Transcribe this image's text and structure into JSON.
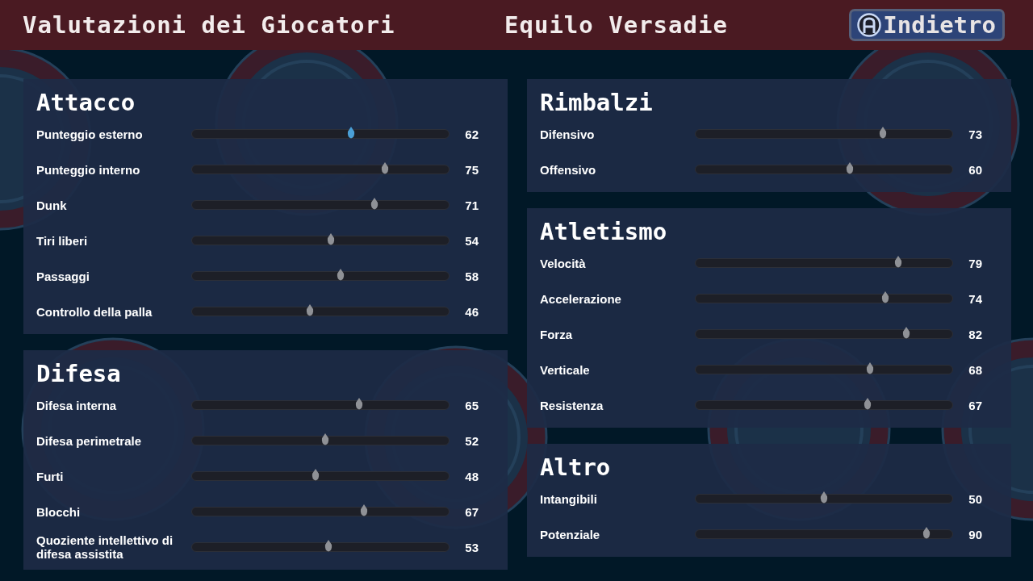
{
  "header": {
    "title": "Valutazioni dei Giocatori",
    "player": "Equilo Versadie",
    "back_button": "Indietro"
  },
  "columns": [
    {
      "sections": [
        {
          "title": "Attacco",
          "stats": [
            {
              "label": "Punteggio esterno",
              "value": "62",
              "level": 0.62,
              "selected": true
            },
            {
              "label": "Punteggio interno",
              "value": "75",
              "level": 0.75,
              "selected": false
            },
            {
              "label": "Dunk",
              "value": "71",
              "level": 0.71,
              "selected": false
            },
            {
              "label": "Tiri liberi",
              "value": "54",
              "level": 0.54,
              "selected": false
            },
            {
              "label": "Passaggi",
              "value": "58",
              "level": 0.58,
              "selected": false
            },
            {
              "label": "Controllo della palla",
              "value": "46",
              "level": 0.46,
              "selected": false
            }
          ]
        },
        {
          "title": "Difesa",
          "stats": [
            {
              "label": "Difesa interna",
              "value": "65",
              "level": 0.65,
              "selected": false
            },
            {
              "label": "Difesa perimetrale",
              "value": "52",
              "level": 0.52,
              "selected": false
            },
            {
              "label": "Furti",
              "value": "48",
              "level": 0.48,
              "selected": false
            },
            {
              "label": "Blocchi",
              "value": "67",
              "level": 0.67,
              "selected": false
            },
            {
              "label": "Quoziente intellettivo di difesa assistita",
              "value": "53",
              "level": 0.53,
              "selected": false
            }
          ]
        }
      ]
    },
    {
      "sections": [
        {
          "title": "Rimbalzi",
          "stats": [
            {
              "label": "Difensivo",
              "value": "73",
              "level": 0.73,
              "selected": false
            },
            {
              "label": "Offensivo",
              "value": "60",
              "level": 0.6,
              "selected": false
            }
          ]
        },
        {
          "title": "Atletismo",
          "stats": [
            {
              "label": "Velocità",
              "value": "79",
              "level": 0.79,
              "selected": false
            },
            {
              "label": "Accelerazione",
              "value": "74",
              "level": 0.74,
              "selected": false
            },
            {
              "label": "Forza",
              "value": "82",
              "level": 0.82,
              "selected": false
            },
            {
              "label": "Verticale",
              "value": "68",
              "level": 0.68,
              "selected": false
            },
            {
              "label": "Resistenza",
              "value": "67",
              "level": 0.67,
              "selected": false
            }
          ]
        },
        {
          "title": "Altro",
          "stats": [
            {
              "label": "Intangibili",
              "value": "50",
              "level": 0.5,
              "selected": false
            },
            {
              "label": "Potenziale",
              "value": "90",
              "level": 0.9,
              "selected": false
            }
          ]
        }
      ]
    }
  ]
}
